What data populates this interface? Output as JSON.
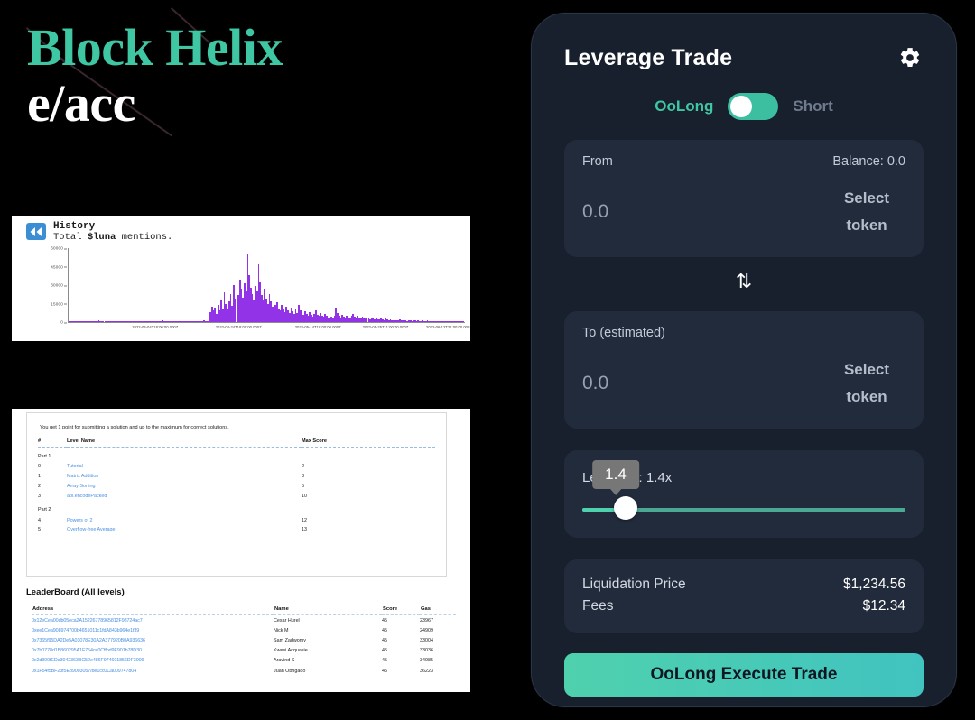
{
  "brand": {
    "line1": "Block Helix",
    "line2": "e/acc"
  },
  "history": {
    "icon": "rewind-icon",
    "title": "History",
    "subtitle_prefix": "Total ",
    "subtitle_token": "$luna",
    "subtitle_suffix": " mentions."
  },
  "chart_data": {
    "type": "bar",
    "title": "Total $luna mentions.",
    "xlabel": "",
    "ylabel": "",
    "ylim": [
      0,
      60000
    ],
    "grid": false,
    "legend": null,
    "ytick_labels": [
      "0",
      "15000",
      "30000",
      "45000",
      "60000"
    ],
    "ytick_values": [
      0,
      15000,
      30000,
      45000,
      60000
    ],
    "xtick_labels": [
      "2022-04-04T18:00:00.000Z",
      "2022-04-24T18:00:00.000Z",
      "2022-05-14T18:00:00.000Z",
      "2022-05-25T11:00:00.000Z",
      "2022-06-12T21:00:00.000Z"
    ],
    "xtick_positions_pct": [
      22,
      43,
      63,
      80,
      96
    ],
    "series_color": "#9333e8",
    "values": [
      600,
      300,
      500,
      900,
      400,
      300,
      700,
      500,
      400,
      900,
      600,
      400,
      300,
      800,
      500,
      400,
      700,
      400,
      500,
      1200,
      600,
      400,
      500,
      900,
      700,
      400,
      600,
      500,
      400,
      900,
      1400,
      700,
      500,
      400,
      600,
      900,
      500,
      400,
      700,
      500,
      400,
      900,
      600,
      1100,
      500,
      400,
      700,
      500,
      900,
      600,
      400,
      500,
      800,
      600,
      400,
      700,
      500,
      900,
      600,
      400,
      1200,
      700,
      500,
      400,
      900,
      600,
      500,
      700,
      400,
      600,
      900,
      500,
      1500,
      800,
      600,
      500,
      900,
      700,
      400,
      600,
      1100,
      700,
      500,
      900,
      600,
      400,
      700,
      1200,
      800,
      600,
      4200,
      7800,
      12500,
      9400,
      11800,
      6900,
      14200,
      9800,
      18500,
      11200,
      24500,
      14800,
      11200,
      16800,
      22400,
      13500,
      29800,
      19200,
      15400,
      21800,
      34500,
      26800,
      19800,
      31200,
      25400,
      55200,
      38400,
      27800,
      22400,
      18600,
      29400,
      24800,
      46800,
      32400,
      21800,
      17400,
      26800,
      19400,
      14800,
      22400,
      16800,
      12400,
      18900,
      13600,
      15800,
      11200,
      9800,
      14200,
      10600,
      8400,
      12800,
      9200,
      7600,
      11400,
      8800,
      6900,
      10200,
      7400,
      13800,
      9600,
      7200,
      5800,
      8900,
      6400,
      5200,
      7800,
      5600,
      4400,
      6800,
      9400,
      6200,
      4800,
      7400,
      5400,
      4200,
      6400,
      4800,
      3800,
      5900,
      4400,
      3400,
      5200,
      11800,
      7400,
      5200,
      4000,
      6200,
      4600,
      3600,
      5400,
      4000,
      3200,
      4800,
      6800,
      4600,
      3400,
      5000,
      3800,
      2900,
      4400,
      3200,
      2600,
      3900,
      2900,
      2300,
      3500,
      2700,
      2100,
      3200,
      2400,
      1900,
      2900,
      2200,
      1700,
      2600,
      2000,
      1600,
      2400,
      1800,
      1400,
      2200,
      1700,
      1300,
      2000,
      1500,
      1200,
      1800,
      1400,
      1100,
      1700,
      1300,
      1000,
      1500,
      1200,
      900,
      1400,
      1100,
      850,
      1300,
      1000,
      800,
      1200,
      950,
      750,
      1100,
      900,
      700,
      1000,
      800,
      650,
      950,
      750,
      600,
      900,
      700,
      550,
      850,
      680,
      540,
      820,
      660,
      520,
      800,
      640,
      500
    ]
  },
  "document": {
    "intro": "You get 1 point for submitting a solution and up to the maximum for correct solutions.",
    "columns": [
      "#",
      "Level Name",
      "Max Score"
    ],
    "sections": [
      {
        "part": "Part 1",
        "rows": [
          {
            "idx": "0",
            "name": "Tutorial",
            "max": "2"
          },
          {
            "idx": "1",
            "name": "Matrix Addition",
            "max": "3"
          },
          {
            "idx": "2",
            "name": "Array Sorting",
            "max": "5"
          },
          {
            "idx": "3",
            "name": "abi.encodePacked",
            "max": "10"
          }
        ]
      },
      {
        "part": "Part 2",
        "rows": [
          {
            "idx": "4",
            "name": "Powers of 2",
            "max": "12"
          },
          {
            "idx": "5",
            "name": "Overflow-free Average",
            "max": "13"
          }
        ]
      }
    ]
  },
  "leaderboard": {
    "title": "LeaderBoard (All levels)",
    "columns": [
      "Address",
      "Name",
      "Score",
      "Gas"
    ],
    "rows": [
      {
        "address": "0x12eCea00db05eca2A15226778965812F98724ac7",
        "name": "Cesar Hurel",
        "score": "45",
        "gas": "23967"
      },
      {
        "address": "0xee1Cea908974700b4651011c1fdA843b964e1f39",
        "name": "Nick M",
        "score": "45",
        "gas": "24909"
      },
      {
        "address": "0x7365f95DA2De5A03078E30A2A377920B0A936636",
        "name": "Sam Zadwomy",
        "score": "45",
        "gas": "33004"
      },
      {
        "address": "0x7b0778d1B860295A1F754ce0Cffbd9E901b78D30",
        "name": "Kwesi Acquasie",
        "score": "45",
        "gas": "33036"
      },
      {
        "address": "0x2d300fEDa3042363BC52e486F974601856DF3009",
        "name": "Aravind S",
        "score": "45",
        "gas": "34985"
      },
      {
        "address": "0x1F54f5BF23f5Eb9003057/be1cc0Ca009747804",
        "name": "Juan Obrigado",
        "score": "45",
        "gas": "36223"
      }
    ]
  },
  "panel": {
    "title": "Leverage Trade",
    "settings_icon": "gear-icon",
    "toggle": {
      "left_label": "OoLong",
      "right_label": "Short",
      "state": "left",
      "accent": "#3bbfa0"
    },
    "from": {
      "label": "From",
      "balance": "Balance: 0.0",
      "amount_value": "0.0",
      "amount_placeholder": "0.0",
      "select_token": "Select token"
    },
    "swap_icon": "⇅",
    "to": {
      "label": "To (estimated)",
      "amount_value": "0.0",
      "amount_placeholder": "0.0",
      "select_token": "Select token"
    },
    "leverage": {
      "label": "Leverage: 1.4x",
      "tooltip": "1.4",
      "value": 1.4,
      "min": 1,
      "max": 10,
      "fill_pct": 10
    },
    "summary": [
      {
        "key": "Liquidation Price",
        "value": "$1,234.56"
      },
      {
        "key": "Fees",
        "value": "$12.34"
      }
    ],
    "execute_label": "OoLong Execute Trade"
  }
}
